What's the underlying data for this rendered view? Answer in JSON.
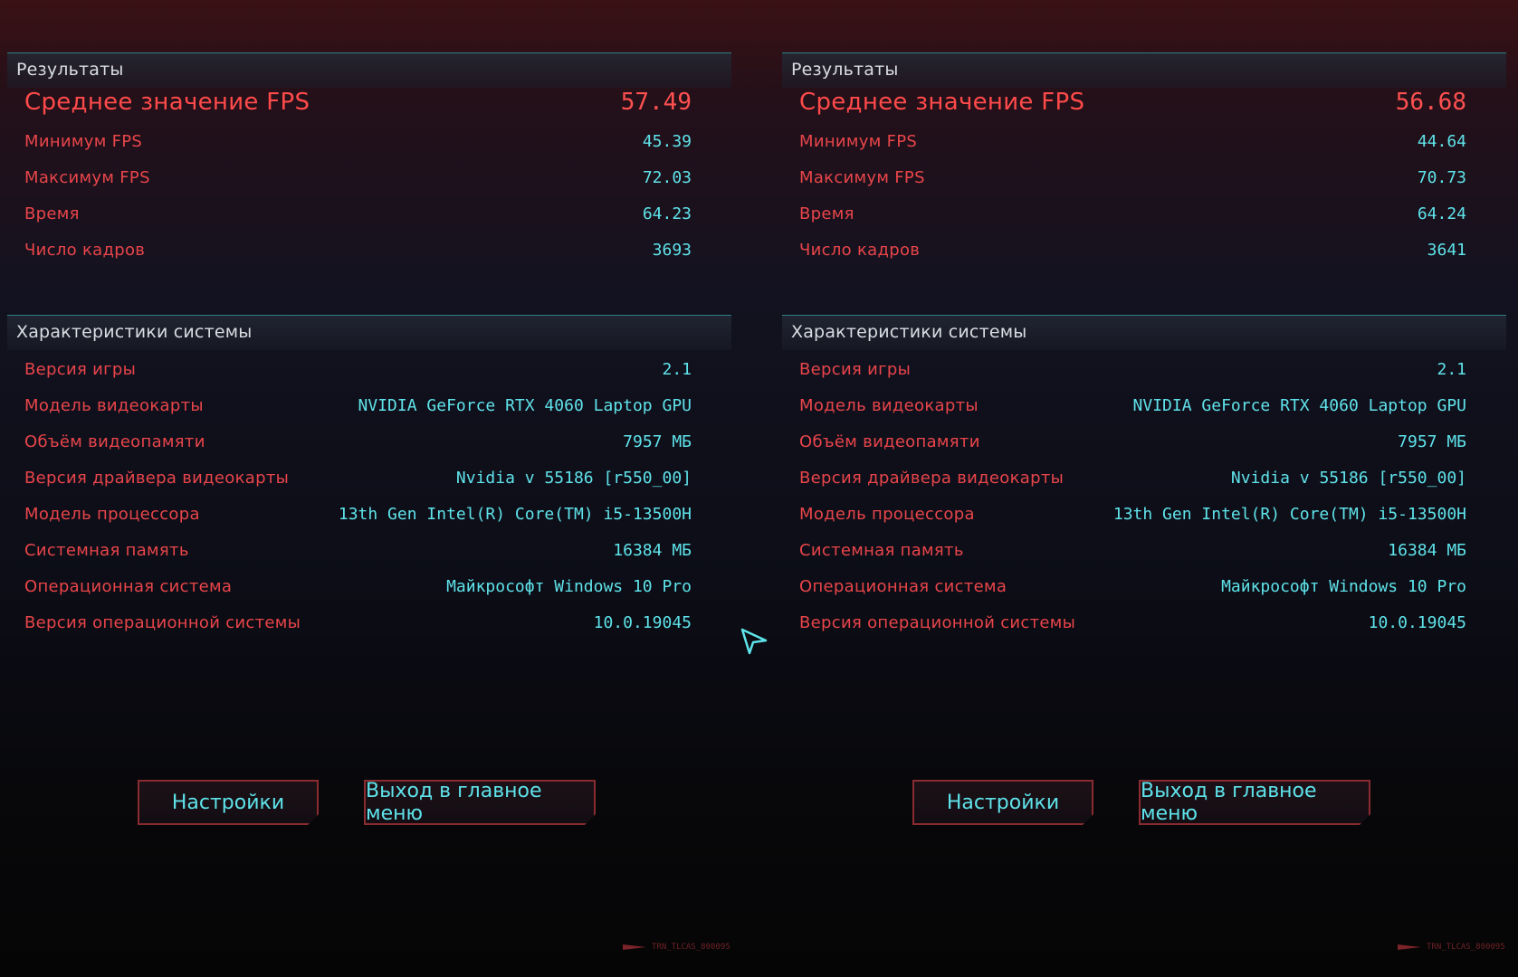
{
  "panels": [
    {
      "results_title": "Результаты",
      "avg_fps_label": "Среднее значение FPS",
      "avg_fps": "57.49",
      "results": [
        {
          "label": "Минимум FPS",
          "value": "45.39"
        },
        {
          "label": "Максимум FPS",
          "value": "72.03"
        },
        {
          "label": "Время",
          "value": "64.23"
        },
        {
          "label": "Число кадров",
          "value": "3693"
        }
      ],
      "system_title": "Характеристики системы",
      "system": [
        {
          "label": "Версия игры",
          "value": "2.1"
        },
        {
          "label": "Модель видеокарты",
          "value": "NVIDIA GeForce RTX 4060 Laptop GPU"
        },
        {
          "label": "Объём видеопамяти",
          "value": "7957 МБ"
        },
        {
          "label": "Версия драйвера видеокарты",
          "value": "Nvidia v 55186 [r550_00]"
        },
        {
          "label": "Модель процессора",
          "value": "13th Gen Intel(R) Core(TM) i5-13500H"
        },
        {
          "label": "Системная память",
          "value": "16384 МБ"
        },
        {
          "label": "Операционная система",
          "value": "Майкрософт Windows 10 Pro"
        },
        {
          "label": "Версия операционной системы",
          "value": "10.0.19045"
        }
      ],
      "settings_button": "Настройки",
      "exit_button": "Выход в главное меню",
      "build_tag": "TRN_TLCAS_800095"
    },
    {
      "results_title": "Результаты",
      "avg_fps_label": "Среднее значение FPS",
      "avg_fps": "56.68",
      "results": [
        {
          "label": "Минимум FPS",
          "value": "44.64"
        },
        {
          "label": "Максимум FPS",
          "value": "70.73"
        },
        {
          "label": "Время",
          "value": "64.24"
        },
        {
          "label": "Число кадров",
          "value": "3641"
        }
      ],
      "system_title": "Характеристики системы",
      "system": [
        {
          "label": "Версия игры",
          "value": "2.1"
        },
        {
          "label": "Модель видеокарты",
          "value": "NVIDIA GeForce RTX 4060 Laptop GPU"
        },
        {
          "label": "Объём видеопамяти",
          "value": "7957 МБ"
        },
        {
          "label": "Версия драйвера видеокарты",
          "value": "Nvidia v 55186 [r550_00]"
        },
        {
          "label": "Модель процессора",
          "value": "13th Gen Intel(R) Core(TM) i5-13500H"
        },
        {
          "label": "Системная память",
          "value": "16384 МБ"
        },
        {
          "label": "Операционная система",
          "value": "Майкрософт Windows 10 Pro"
        },
        {
          "label": "Версия операционной системы",
          "value": "10.0.19045"
        }
      ],
      "settings_button": "Настройки",
      "exit_button": "Выход в главное меню",
      "build_tag": "TRN_TLCAS_800095"
    }
  ],
  "colors": {
    "label_red": "#e8454a",
    "value_cyan": "#5fe3ea",
    "header_text": "#d9dde2",
    "divider_teal": "#2f7f87",
    "button_border": "#8a2b30"
  },
  "cursor_icon": "pointer-arrow-icon"
}
